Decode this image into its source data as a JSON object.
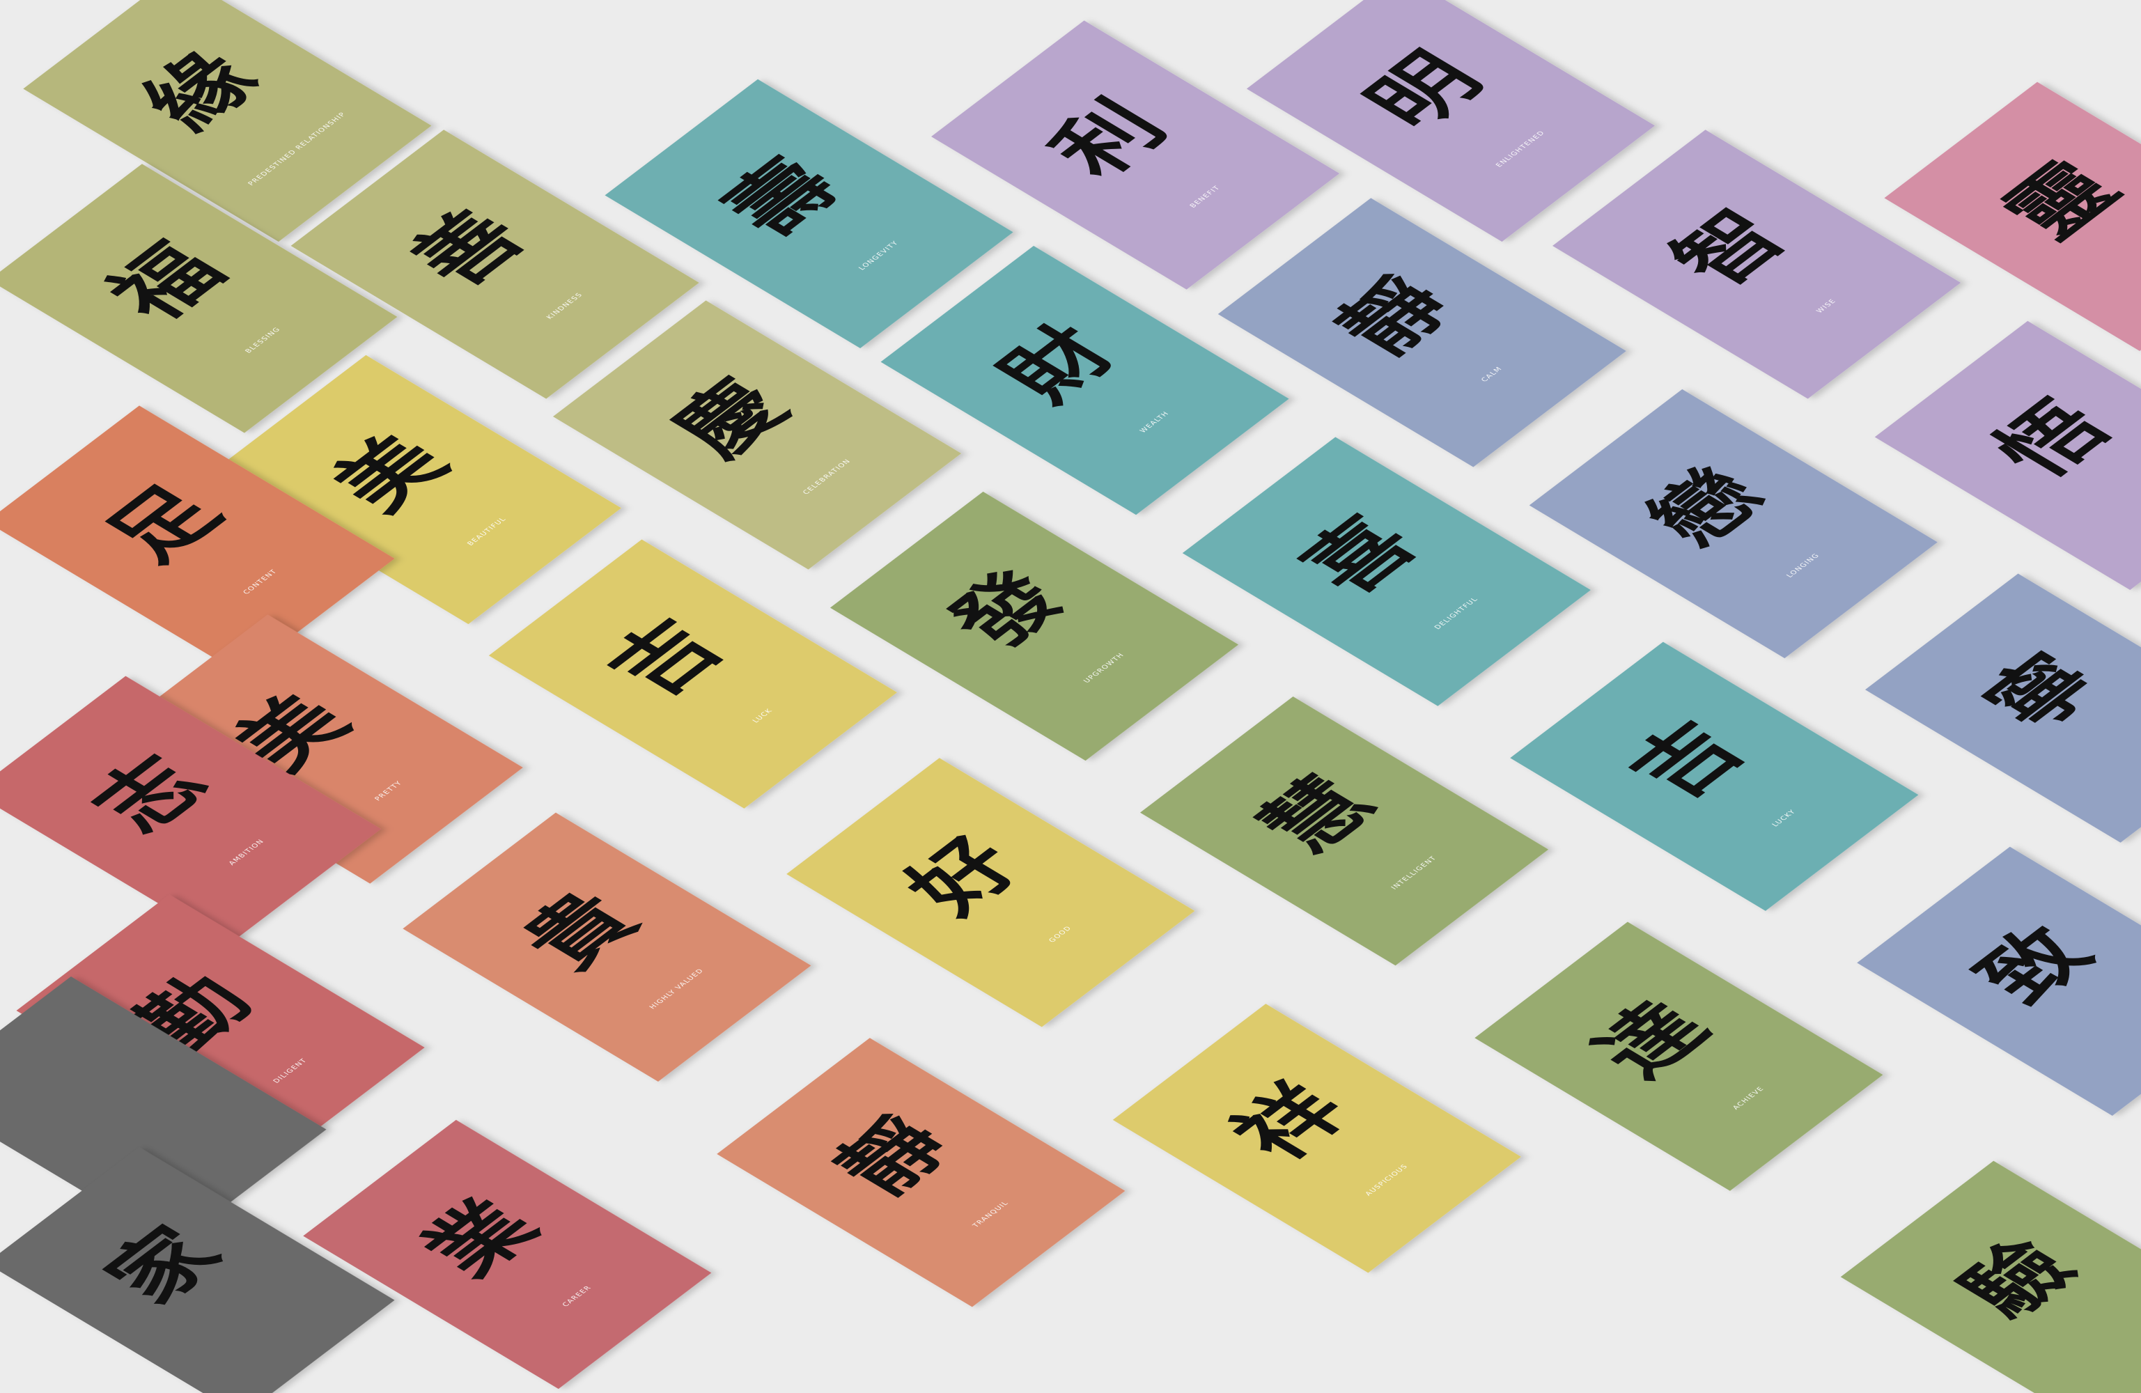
{
  "cards": [
    {
      "character": "緣",
      "label": "PREDESTINED RELATIONSHIP",
      "color": "#b6b77b"
    },
    {
      "character": "福",
      "label": "BLESSING",
      "color": "#b4b577"
    },
    {
      "character": "善",
      "label": "KINDNESS",
      "color": "#b9b97e"
    },
    {
      "character": "壽",
      "label": "LONGEVITY",
      "color": "#6eafb1"
    },
    {
      "character": "利",
      "label": "BENEFIT",
      "color": "#b9a6cd"
    },
    {
      "character": "明",
      "label": "ENLIGHTENED",
      "color": "#b7a5cc"
    },
    {
      "character": "靈",
      "label": "",
      "color": "#d48fa5"
    },
    {
      "character": "智",
      "label": "WISE",
      "color": "#b7a5cc"
    },
    {
      "character": "靜",
      "label": "CALM",
      "color": "#94a3c3"
    },
    {
      "character": "財",
      "label": "WEALTH",
      "color": "#6cafb2"
    },
    {
      "character": "慶",
      "label": "CELEBRATION",
      "color": "#bebd85"
    },
    {
      "character": "美",
      "label": "BEAUTIFUL",
      "color": "#dccb6b"
    },
    {
      "character": "足",
      "label": "CONTENT",
      "color": "#d9805f"
    },
    {
      "character": "吉",
      "label": "LUCK",
      "color": "#ddcb6c"
    },
    {
      "character": "發",
      "label": "UPGROWTH",
      "color": "#98ab70"
    },
    {
      "character": "喜",
      "label": "DELIGHTFUL",
      "color": "#6db0b2"
    },
    {
      "character": "戀",
      "label": "LONGING",
      "color": "#95a3c4"
    },
    {
      "character": "悟",
      "label": "",
      "color": "#b8a5cc"
    },
    {
      "character": "寧",
      "label": "",
      "color": "#93a2c3"
    },
    {
      "character": "吉",
      "label": "LUCKY",
      "color": "#6cafb2"
    },
    {
      "character": "慧",
      "label": "INTELLIGENT",
      "color": "#98ab70"
    },
    {
      "character": "好",
      "label": "GOOD",
      "color": "#ddcb6c"
    },
    {
      "character": "美",
      "label": "PRETTY",
      "color": "#d9856a"
    },
    {
      "character": "志",
      "label": "AMBITION",
      "color": "#c6676b"
    },
    {
      "character": "勤",
      "label": "DILIGENT",
      "color": "#c6686b"
    },
    {
      "character": "貴",
      "label": "HIGHLY VALUED",
      "color": "#d98c70"
    },
    {
      "character": "靜",
      "label": "TRANQUIL",
      "color": "#d98d70"
    },
    {
      "character": "祥",
      "label": "AUSPICIOUS",
      "color": "#ddcb6c"
    },
    {
      "character": "達",
      "label": "ACHIEVE",
      "color": "#98ab70"
    },
    {
      "character": "致",
      "label": "",
      "color": "#93a2c3"
    },
    {
      "character": "業",
      "label": "CAREER",
      "color": "#c46a6f"
    },
    {
      "character": "",
      "label": "",
      "color": "#6a6a6a"
    },
    {
      "character": "家",
      "label": "",
      "color": "#6a6a6a"
    },
    {
      "character": "驗",
      "label": "",
      "color": "#98ab70"
    }
  ]
}
